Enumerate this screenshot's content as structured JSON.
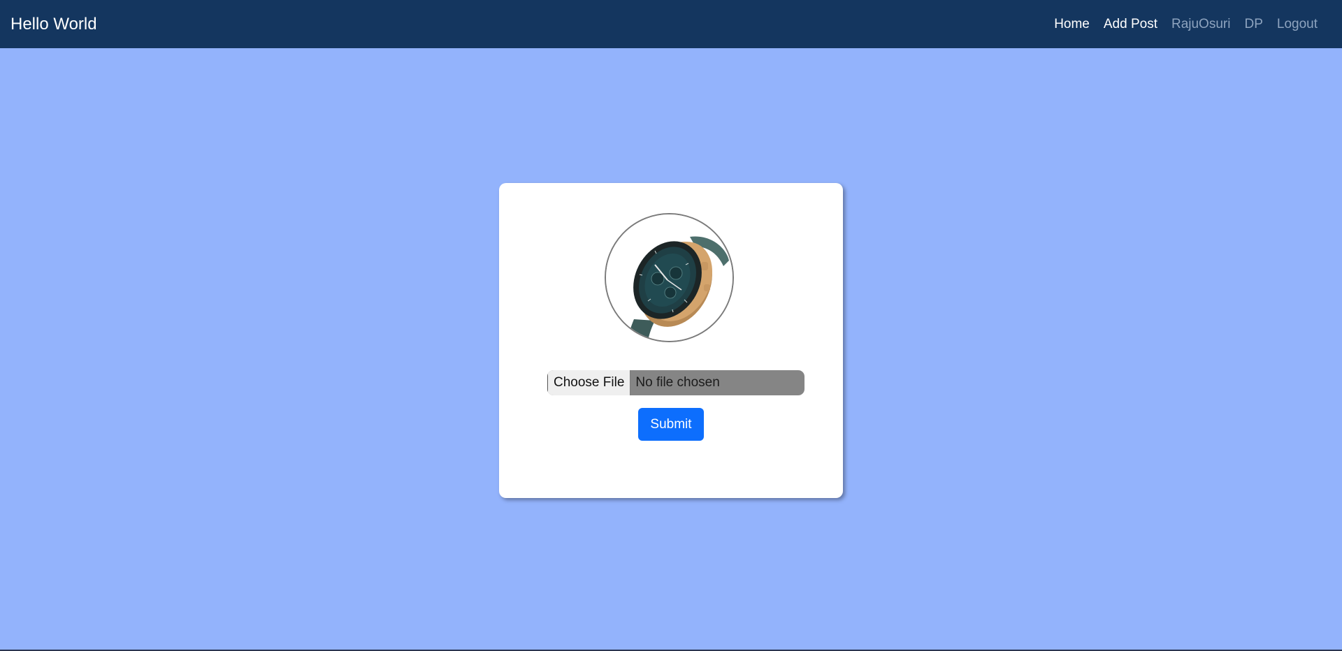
{
  "navbar": {
    "brand": "Hello World",
    "links": [
      {
        "label": "Home"
      },
      {
        "label": "Add Post"
      },
      {
        "label": "RajuOsuri"
      },
      {
        "label": "DP"
      },
      {
        "label": "Logout"
      }
    ]
  },
  "upload": {
    "choose_file_label": "Choose File",
    "file_status": "No file chosen",
    "submit_label": "Submit",
    "avatar_image": "smartwatch-photo"
  },
  "colors": {
    "navbar_bg": "#14365f",
    "page_bg": "#93b3fc",
    "primary_button": "#0d6efd"
  }
}
